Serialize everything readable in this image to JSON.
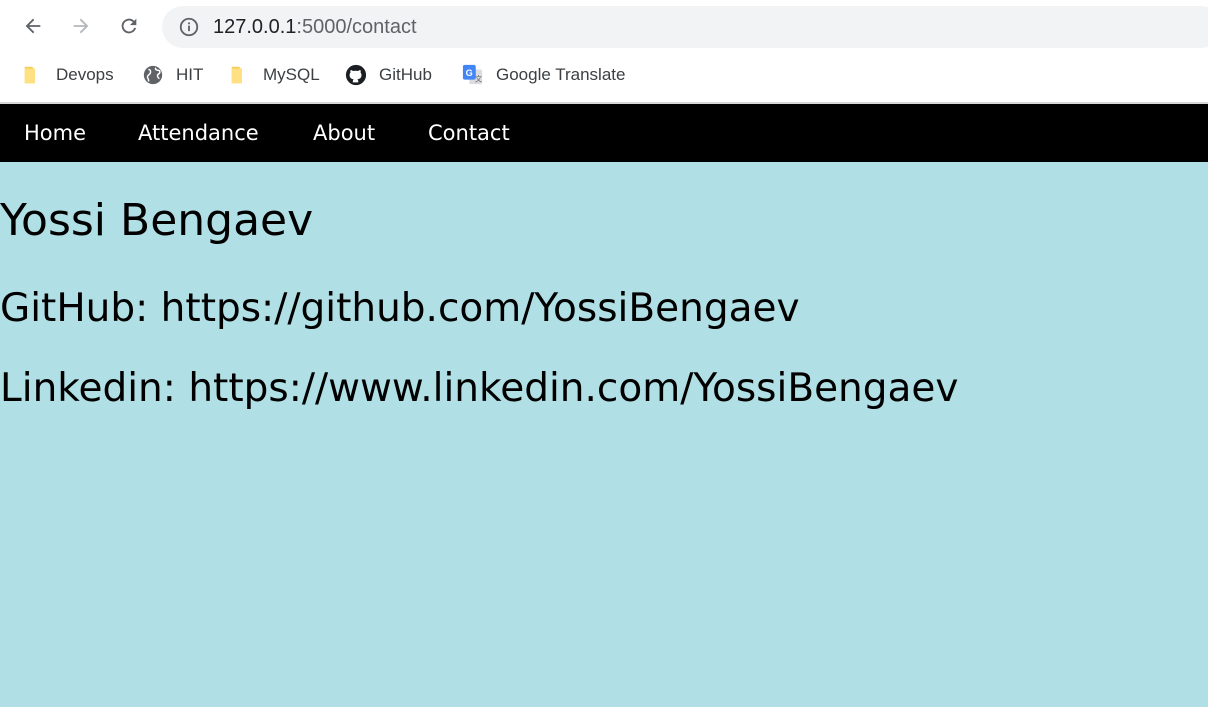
{
  "browser": {
    "url_host": "127.0.0.1",
    "url_rest": ":5000/contact"
  },
  "bookmarks": [
    {
      "label": "Devops",
      "icon": "folder-icon"
    },
    {
      "label": "HIT",
      "icon": "globe-icon"
    },
    {
      "label": "MySQL",
      "icon": "folder-icon"
    },
    {
      "label": "GitHub",
      "icon": "github-icon"
    },
    {
      "label": "Google Translate",
      "icon": "google-translate-icon"
    }
  ],
  "nav": {
    "items": [
      "Home",
      "Attendance",
      "About",
      "Contact"
    ]
  },
  "contact": {
    "name": "Yossi Bengaev",
    "github_line": "GitHub: https://github.com/YossiBengaev",
    "linkedin_line": "Linkedin: https://www.linkedin.com/YossiBengaev"
  },
  "colors": {
    "page_background": "#b0dfe5",
    "nav_background": "#000000",
    "nav_text": "#ffffff"
  }
}
